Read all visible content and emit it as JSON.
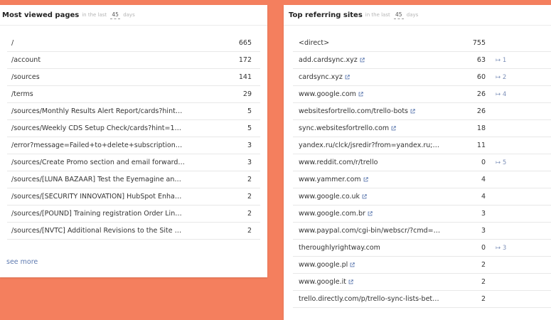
{
  "left_card": {
    "title": "Most viewed pages",
    "sub_prefix": "in the last",
    "days": "45",
    "sub_suffix": "days",
    "rows": [
      {
        "label": "/",
        "count": "665"
      },
      {
        "label": "/account",
        "count": "172"
      },
      {
        "label": "/sources",
        "count": "141"
      },
      {
        "label": "/terms",
        "count": "29"
      },
      {
        "label": "/sources/Monthly Results Alert Report/cards?hint=1…",
        "count": "5"
      },
      {
        "label": "/sources/Weekly CDS Setup Check/cards?hint=131658",
        "count": "5"
      },
      {
        "label": "/error?message=Failed+to+delete+subscription+I-W3…",
        "count": "3"
      },
      {
        "label": "/sources/Create Promo section and email forwarder …",
        "count": "3"
      },
      {
        "label": "/sources/[LUNA BAZAAR] Test the Eyemagine and M…",
        "count": "2"
      },
      {
        "label": "/sources/[SECURITY INNOVATION] HubSpot Enhance…",
        "count": "2"
      },
      {
        "label": "/sources/[POUND] Training registration Order Lines …",
        "count": "2"
      },
      {
        "label": "/sources/[NVTC] Additional Revisions to the Site Upd…",
        "count": "2"
      }
    ],
    "see_more": "see more"
  },
  "right_card": {
    "title": "Top referring sites",
    "sub_prefix": "in the last",
    "days": "45",
    "sub_suffix": "days",
    "rows": [
      {
        "label": "<direct>",
        "count": "755",
        "link": false,
        "rank": ""
      },
      {
        "label": "add.cardsync.xyz",
        "count": "63",
        "link": true,
        "rank": "↦ 1"
      },
      {
        "label": "cardsync.xyz",
        "count": "60",
        "link": true,
        "rank": "↦ 2"
      },
      {
        "label": "www.google.com",
        "count": "26",
        "link": true,
        "rank": "↦ 4"
      },
      {
        "label": "websitesfortrello.com/trello-bots",
        "count": "26",
        "link": true,
        "rank": ""
      },
      {
        "label": "sync.websitesfortrello.com",
        "count": "18",
        "link": true,
        "rank": ""
      },
      {
        "label": "yandex.ru/clck/jsredir?from=yandex.ru;…",
        "count": "11",
        "link": false,
        "rank": ""
      },
      {
        "label": "www.reddit.com/r/trello",
        "count": "0",
        "link": false,
        "rank": "↦ 5"
      },
      {
        "label": "www.yammer.com",
        "count": "4",
        "link": true,
        "rank": ""
      },
      {
        "label": "www.google.co.uk",
        "count": "4",
        "link": true,
        "rank": ""
      },
      {
        "label": "www.google.com.br",
        "count": "3",
        "link": true,
        "rank": ""
      },
      {
        "label": "www.paypal.com/cgi-bin/webscr/?cmd=_…",
        "count": "3",
        "link": false,
        "rank": ""
      },
      {
        "label": "theroughlyrightway.com",
        "count": "0",
        "link": false,
        "rank": "↦ 3"
      },
      {
        "label": "www.google.pl",
        "count": "2",
        "link": true,
        "rank": ""
      },
      {
        "label": "www.google.it",
        "count": "2",
        "link": true,
        "rank": ""
      },
      {
        "label": "trello.directly.com/p/trello-sync-lists-bet…",
        "count": "2",
        "link": false,
        "rank": ""
      }
    ]
  },
  "colors": {
    "background": "#f47f5e",
    "link": "#5e7ab0",
    "rank": "#7c8fb8"
  }
}
